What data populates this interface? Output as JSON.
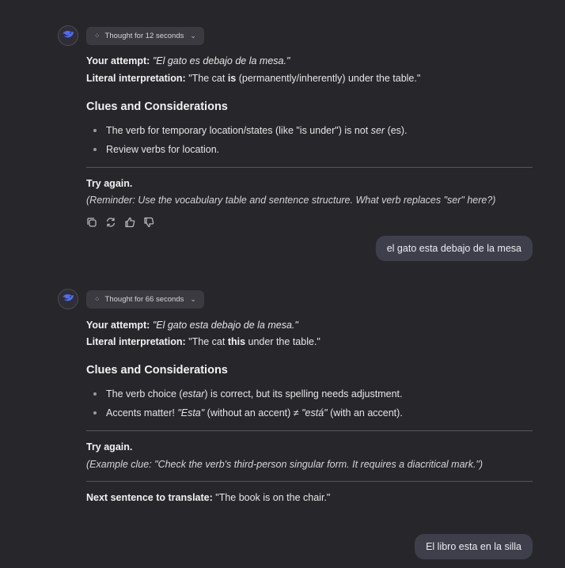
{
  "block1": {
    "thought_label": "Thought for 12 seconds",
    "attempt_label": "Your attempt:",
    "attempt_value": "\"El gato es debajo de la mesa.\"",
    "literal_label": "Literal interpretation:",
    "literal_pre": "\"The cat ",
    "literal_bold": "is",
    "literal_post": " (permanently/inherently) under the table.\"",
    "heading": "Clues and Considerations",
    "bullet1_pre": "The verb for temporary location/states (like \"is under\") is not ",
    "bullet1_italic": "ser",
    "bullet1_post": " (es).",
    "bullet2": "Review verbs for location.",
    "try_again": "Try again.",
    "reminder": "(Reminder: Use the vocabulary table and sentence structure. What verb replaces \"ser\" here?)"
  },
  "user1": {
    "message": "el gato esta debajo de la mesa"
  },
  "block2": {
    "thought_label": "Thought for 66 seconds",
    "attempt_label": "Your attempt:",
    "attempt_value": "\"El gato esta debajo de la mesa.\"",
    "literal_label": "Literal interpretation:",
    "literal_pre": "\"The cat ",
    "literal_bold": "this",
    "literal_post": " under the table.\"",
    "heading": "Clues and Considerations",
    "bullet1_pre": "The verb choice (",
    "bullet1_italic": "estar",
    "bullet1_post": ") is correct, but its spelling needs adjustment.",
    "bullet2_pre": "Accents matter! ",
    "bullet2_i1": "\"Esta\"",
    "bullet2_mid": " (without an accent) ≠ ",
    "bullet2_i2": "\"está\"",
    "bullet2_post": " (with an accent).",
    "try_again": "Try again.",
    "example": "(Example clue: \"Check the verb's third-person singular form. It requires a diacritical mark.\")",
    "next_label": "Next sentence to translate:",
    "next_value": " \"The book is on the chair.\""
  },
  "user2": {
    "message": "El libro esta en la silla"
  },
  "icons": {
    "avatar": "assistant-logo-icon",
    "thought": "thought-icon",
    "chevron": "chevron-down-icon",
    "copy": "copy-icon",
    "regenerate": "regenerate-icon",
    "thumbs_up": "thumbs-up-icon",
    "thumbs_down": "thumbs-down-icon"
  },
  "colors": {
    "background": "#27272b",
    "user_bubble": "#3f3f4c",
    "thought_button": "#3a3a40",
    "accent_logo": "#4d6bfe"
  }
}
